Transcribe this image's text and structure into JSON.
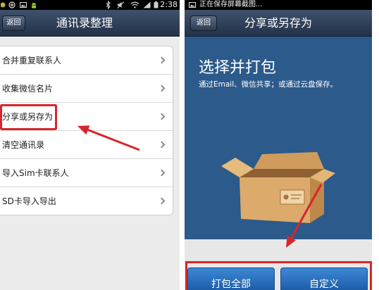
{
  "left": {
    "status_bar": {
      "time": "2:38",
      "icons_left": [
        "notification-icon",
        "add-circle-icon",
        "image-icon",
        "android-icon"
      ],
      "icons_right": [
        "bluetooth-icon",
        "mute-icon",
        "wifi-icon",
        "signal-icon",
        "battery-icon"
      ]
    },
    "header": {
      "back_label": "返回",
      "title": "通讯录整理"
    },
    "items": [
      {
        "label": "合并重复联系人",
        "icon": "chevron-right-icon"
      },
      {
        "label": "收集微信名片",
        "icon": "chevron-right-icon"
      },
      {
        "label": "分享或另存为",
        "icon": "chevron-right-icon"
      },
      {
        "label": "清空通讯录",
        "icon": "chevron-right-icon"
      },
      {
        "label": "导入Sim卡联系人",
        "icon": "chevron-right-icon"
      },
      {
        "label": "SD卡导入导出",
        "icon": "chevron-right-icon"
      }
    ]
  },
  "right": {
    "status_bar": {
      "icon": "image-icon",
      "notification": "正在保存屏幕截图..."
    },
    "header": {
      "back_label": "返回",
      "title": "分享或另存为"
    },
    "hero": {
      "title": "选择并打包",
      "subtitle": "通过Email、微信共享；或通过云盘保存。",
      "illustration": "cardboard-box-icon"
    },
    "actions": {
      "pack_all_label": "打包全部",
      "custom_label": "自定义"
    }
  },
  "colors": {
    "header": "#2c3a50",
    "hero": "#2c5a8b",
    "button": "#2a72c0",
    "annotation": "#d7262b"
  }
}
